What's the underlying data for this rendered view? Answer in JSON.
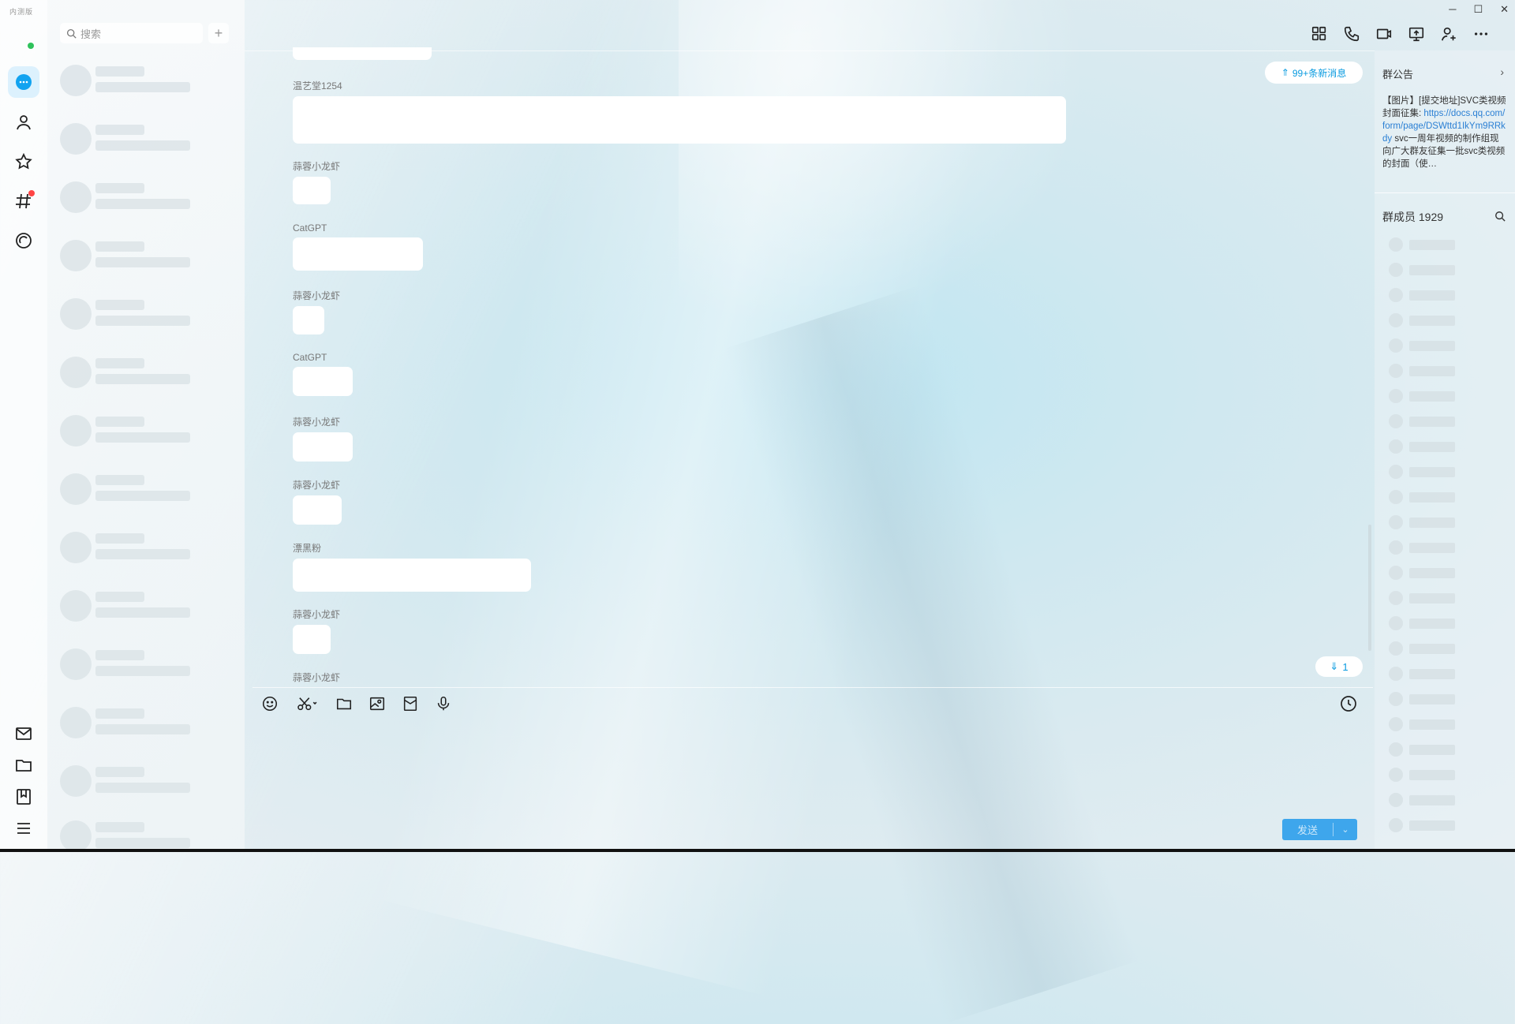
{
  "app": {
    "brand": "内测版"
  },
  "search": {
    "placeholder": "搜索",
    "add_label": "+"
  },
  "window_controls": {
    "minimize": "─",
    "maximize": "☐",
    "close": "✕"
  },
  "header": {
    "icons": [
      "apps-icon",
      "phone-icon",
      "video-icon",
      "screen-share-icon",
      "add-member-icon",
      "more-icon"
    ]
  },
  "messages": [
    {
      "sender": "",
      "w": 0
    },
    {
      "sender": "温艺堂1254"
    },
    {
      "sender": "蒜蓉小龙虾"
    },
    {
      "sender": "CatGPT"
    },
    {
      "sender": "蒜蓉小龙虾"
    },
    {
      "sender": "CatGPT"
    },
    {
      "sender": "蒜蓉小龙虾"
    },
    {
      "sender": "蒜蓉小龙虾"
    },
    {
      "sender": "漂黑粉"
    },
    {
      "sender": "蒜蓉小龙虾"
    },
    {
      "sender": "蒜蓉小龙虾"
    }
  ],
  "new_messages_pill": "99+条新消息",
  "down_pill": "1",
  "send": {
    "label": "发送",
    "arrow": "⌄"
  },
  "announcement": {
    "title": "群公告",
    "arrow": "›",
    "text_prefix": "【图片】[提交地址]SVC类视频封面征集: ",
    "link": "https://docs.qq.com/form/page/DSWttd1IkYm9RRkdy",
    "text_suffix": " svc一周年视频的制作组现向广大群友征集一批svc类视频的封面（使…"
  },
  "members": {
    "title": "群成员",
    "count": "1929"
  },
  "colors": {
    "accent": "#0a9be0",
    "send": "#3ea6ec",
    "online": "#2fc25b",
    "badge": "#ff4444"
  }
}
